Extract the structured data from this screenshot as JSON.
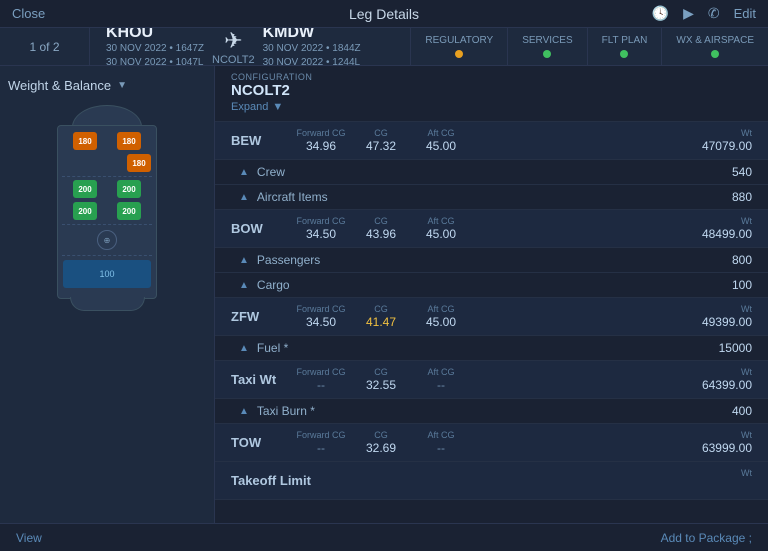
{
  "header": {
    "close_label": "Close",
    "title": "Leg Details",
    "edit_label": "Edit"
  },
  "nav": {
    "page_label": "1 of 2",
    "origin": {
      "code": "KHOU",
      "dep_date": "30 NOV 2022 • 1647Z",
      "arr_date": "30 NOV 2022 • 1047L"
    },
    "destination": {
      "code": "KMDW",
      "dep_date": "30 NOV 2022 • 1844Z",
      "arr_date": "30 NOV 2022 • 1244L"
    },
    "aircraft_label": "NCOLT2",
    "badges": [
      {
        "label": "REGULATORY",
        "dot_color": "orange"
      },
      {
        "label": "SERVICES",
        "dot_color": "green"
      },
      {
        "label": "FLT PLAN",
        "dot_color": "green"
      },
      {
        "label": "WX & AIRSPACE",
        "dot_color": "green"
      }
    ]
  },
  "panel": {
    "config_label": "CONFIGURATION",
    "config_name": "NCOLT2",
    "expand_label": "Expand"
  },
  "wb": {
    "title": "Weight & Balance"
  },
  "weights": [
    {
      "id": "BEW",
      "label": "BEW",
      "forward_cg_label": "Forward CG",
      "forward_cg": "34.96",
      "cg_label": "CG",
      "cg": "47.32",
      "aft_cg_label": "Aft CG",
      "aft_cg": "45.00",
      "wt_label": "Wt",
      "wt": "47079.00",
      "sub_rows": [
        {
          "label": "Crew",
          "value": "540"
        },
        {
          "label": "Aircraft Items",
          "value": "880"
        }
      ]
    },
    {
      "id": "BOW",
      "label": "BOW",
      "forward_cg": "34.50",
      "cg": "43.96",
      "aft_cg": "45.00",
      "wt": "48499.00",
      "sub_rows": [
        {
          "label": "Passengers",
          "value": "800"
        },
        {
          "label": "Cargo",
          "value": "100"
        }
      ]
    },
    {
      "id": "ZFW",
      "label": "ZFW",
      "forward_cg": "34.50",
      "cg": "41.47",
      "aft_cg": "45.00",
      "wt": "49399.00",
      "cg_highlight": true,
      "sub_rows": [
        {
          "label": "Fuel *",
          "value": "15000"
        }
      ]
    },
    {
      "id": "TaxiWt",
      "label": "Taxi Wt",
      "forward_cg": "--",
      "cg": "32.55",
      "aft_cg": "--",
      "wt": "64399.00",
      "sub_rows": [
        {
          "label": "Taxi Burn *",
          "value": "400"
        }
      ]
    },
    {
      "id": "TOW",
      "label": "TOW",
      "forward_cg": "--",
      "cg": "32.69",
      "aft_cg": "--",
      "wt": "63999.00",
      "sub_rows": []
    },
    {
      "id": "TakeoffLimit",
      "label": "Takeoff Limit",
      "forward_cg": "",
      "cg": "",
      "aft_cg": "",
      "wt": "",
      "sub_rows": []
    }
  ],
  "bottom_bar": {
    "view_label": "View",
    "add_to_package_label": "Add to Package ;"
  },
  "seat_sections": {
    "blue_label": "100"
  }
}
